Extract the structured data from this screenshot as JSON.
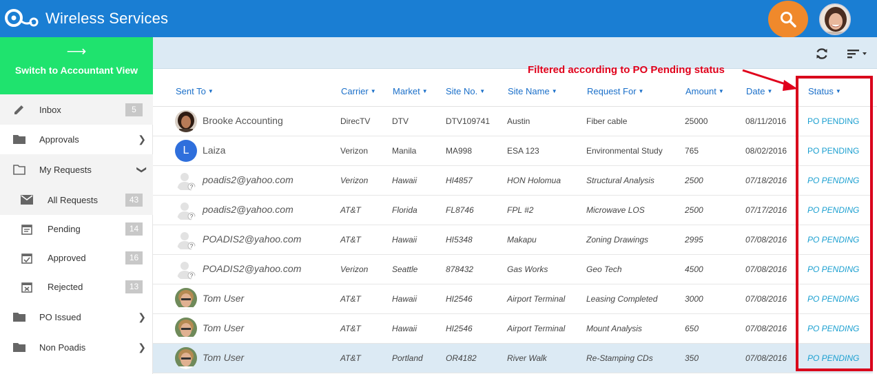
{
  "app": {
    "title": "Wireless Services"
  },
  "sidebar": {
    "switch_label": "Switch to Accountant View",
    "switch_arrow": "⟶",
    "items": [
      {
        "label": "Inbox",
        "count": "5",
        "icon": "pencil-icon"
      },
      {
        "label": "Approvals",
        "icon": "folder-icon"
      },
      {
        "label": "My Requests",
        "icon": "folder-open-icon"
      },
      {
        "label": "All Requests",
        "count": "43",
        "icon": "mail-icon"
      },
      {
        "label": "Pending",
        "count": "14",
        "icon": "calendar-icon"
      },
      {
        "label": "Approved",
        "count": "16",
        "icon": "calendar-check-icon"
      },
      {
        "label": "Rejected",
        "count": "13",
        "icon": "calendar-x-icon"
      },
      {
        "label": "PO Issued",
        "icon": "folder-icon"
      },
      {
        "label": "Non Poadis",
        "icon": "folder-icon"
      }
    ]
  },
  "table": {
    "columns": [
      "Sent To",
      "Carrier",
      "Market",
      "Site No.",
      "Site Name",
      "Request For",
      "Amount",
      "Date",
      "Status"
    ],
    "rows": [
      {
        "sent_to": "Brooke Accounting",
        "carrier": "DirecTV",
        "market": "DTV",
        "site_no": "DTV109741",
        "site_name": "Austin",
        "request_for": "Fiber cable",
        "amount": "25000",
        "date": "08/11/2016",
        "status": "PO PENDING"
      },
      {
        "sent_to": "Laiza",
        "avatar_letter": "L",
        "carrier": "Verizon",
        "market": "Manila",
        "site_no": "MA998",
        "site_name": "ESA 123",
        "request_for": "Environmental Study",
        "amount": "765",
        "date": "08/02/2016",
        "status": "PO PENDING"
      },
      {
        "sent_to": "poadis2@yahoo.com",
        "carrier": "Verizon",
        "market": "Hawaii",
        "site_no": "HI4857",
        "site_name": "HON Holomua",
        "request_for": "Structural Analysis",
        "amount": "2500",
        "date": "07/18/2016",
        "status": "PO PENDING"
      },
      {
        "sent_to": "poadis2@yahoo.com",
        "carrier": "AT&T",
        "market": "Florida",
        "site_no": "FL8746",
        "site_name": "FPL #2",
        "request_for": "Microwave LOS",
        "amount": "2500",
        "date": "07/17/2016",
        "status": "PO PENDING"
      },
      {
        "sent_to": "POADIS2@yahoo.com",
        "carrier": "AT&T",
        "market": "Hawaii",
        "site_no": "HI5348",
        "site_name": "Makapu",
        "request_for": "Zoning Drawings",
        "amount": "2995",
        "date": "07/08/2016",
        "status": "PO PENDING"
      },
      {
        "sent_to": "POADIS2@yahoo.com",
        "carrier": "Verizon",
        "market": "Seattle",
        "site_no": "878432",
        "site_name": "Gas Works",
        "request_for": "Geo Tech",
        "amount": "4500",
        "date": "07/08/2016",
        "status": "PO PENDING"
      },
      {
        "sent_to": "Tom User",
        "carrier": "AT&T",
        "market": "Hawaii",
        "site_no": "HI2546",
        "site_name": "Airport Terminal",
        "request_for": "Leasing Completed",
        "amount": "3000",
        "date": "07/08/2016",
        "status": "PO PENDING"
      },
      {
        "sent_to": "Tom User",
        "carrier": "AT&T",
        "market": "Hawaii",
        "site_no": "HI2546",
        "site_name": "Airport Terminal",
        "request_for": "Mount Analysis",
        "amount": "650",
        "date": "07/08/2016",
        "status": "PO PENDING"
      },
      {
        "sent_to": "Tom User",
        "carrier": "AT&T",
        "market": "Portland",
        "site_no": "OR4182",
        "site_name": "River Walk",
        "request_for": "Re-Stamping CDs",
        "amount": "350",
        "date": "07/08/2016",
        "status": "PO PENDING"
      }
    ]
  },
  "annotation": {
    "text": "Filtered according to PO Pending status"
  },
  "colors": {
    "brand": "#1a7ed3",
    "switch": "#1fe36e",
    "search": "#f0892b",
    "status": "#1a9fd0",
    "annotation": "#d9001b"
  }
}
